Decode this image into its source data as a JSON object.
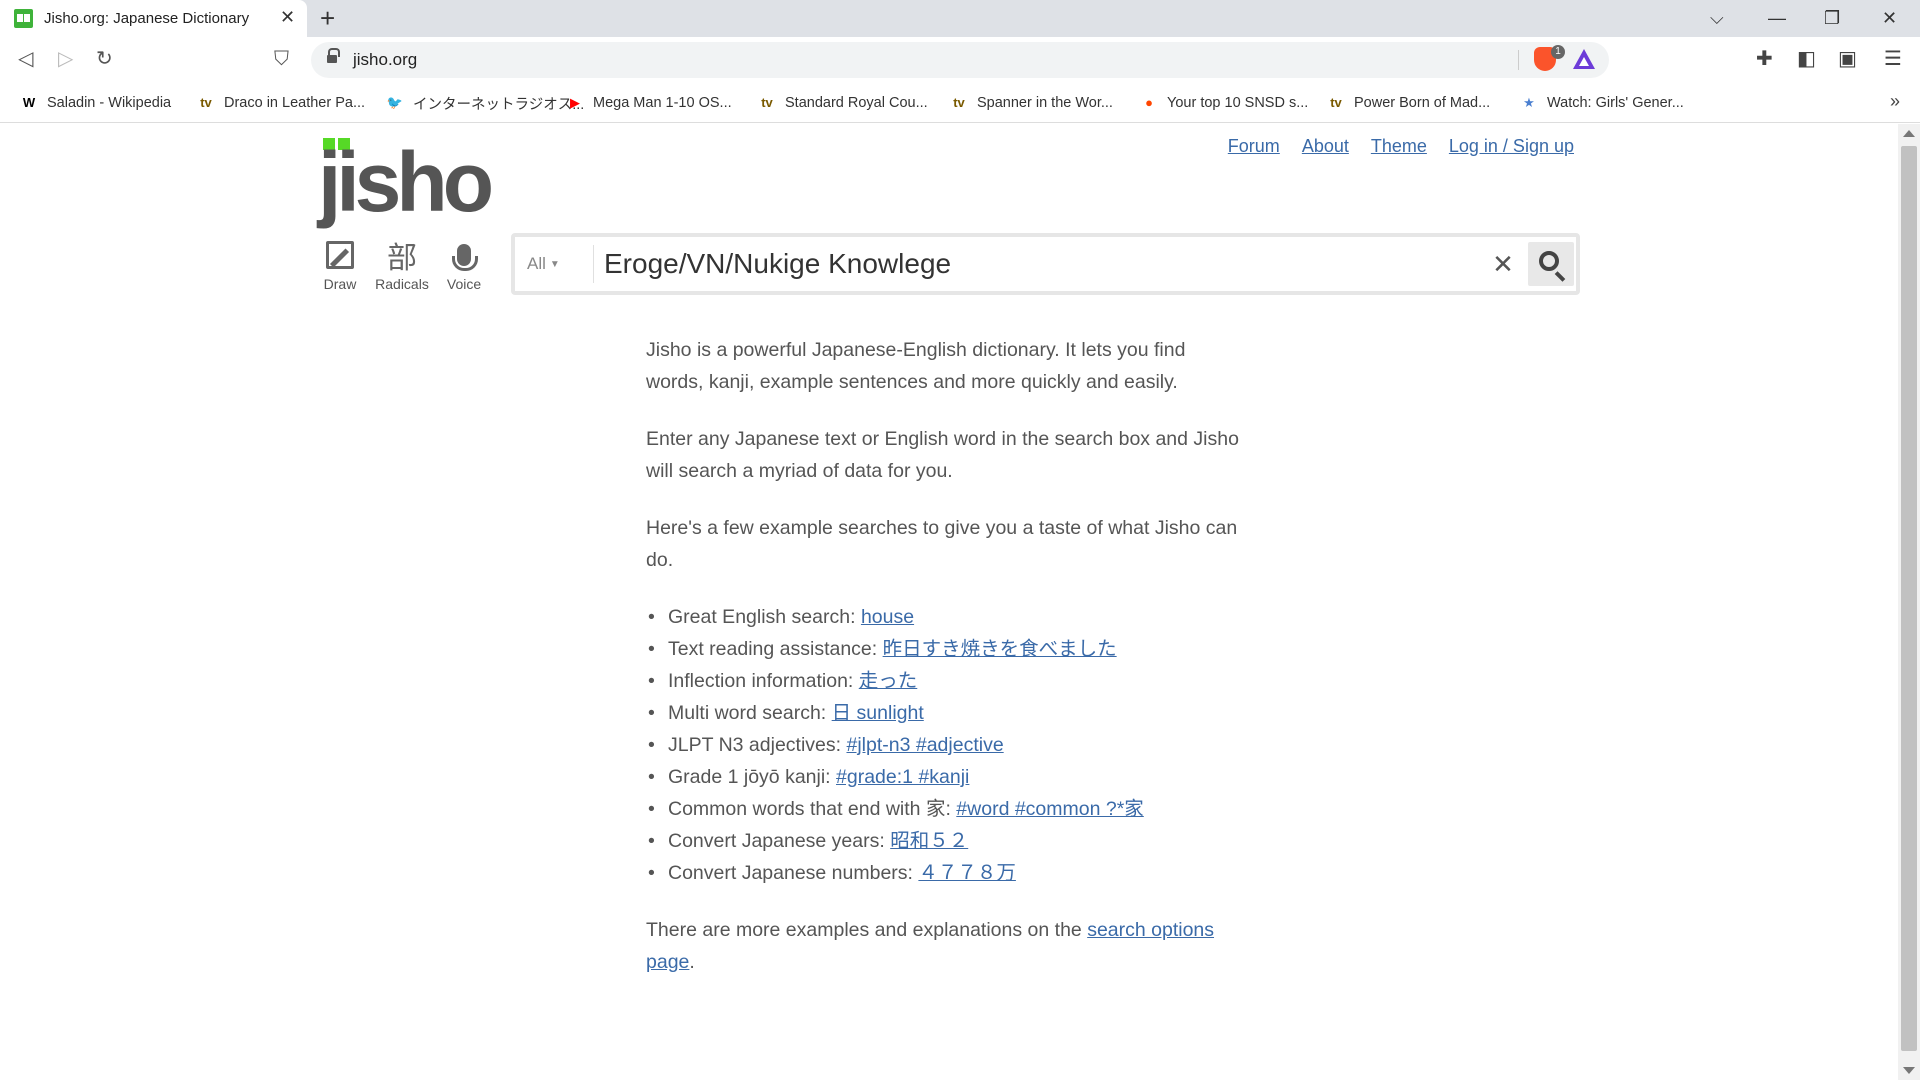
{
  "browser": {
    "tab_title": "Jisho.org: Japanese Dictionary",
    "tab_close": "✕",
    "new_tab": "+",
    "url": "jisho.org",
    "brave_badge": "1",
    "window_controls": [
      "⌵",
      "—",
      "❐",
      "✕"
    ],
    "bookmarks": [
      {
        "label": "Saladin - Wikipedia",
        "icon": "wikipedia-icon",
        "glyph": "W",
        "color": "#000000"
      },
      {
        "label": "Draco in Leather Pa...",
        "icon": "tvtropes-icon",
        "glyph": "tv",
        "color": "#7a5a00"
      },
      {
        "label": "インターネットラジオス...",
        "icon": "twitter-icon",
        "glyph": "🐦",
        "color": "#1d9bf0"
      },
      {
        "label": "Mega Man 1-10 OS...",
        "icon": "youtube-icon",
        "glyph": "▶",
        "color": "#ff0000"
      },
      {
        "label": "Standard Royal Cou...",
        "icon": "tvtropes-icon",
        "glyph": "tv",
        "color": "#7a5a00"
      },
      {
        "label": "Spanner in the Wor...",
        "icon": "tvtropes-icon",
        "glyph": "tv",
        "color": "#7a5a00"
      },
      {
        "label": "Your top 10 SNSD s...",
        "icon": "reddit-icon",
        "glyph": "●",
        "color": "#ff4500"
      },
      {
        "label": "Power Born of Mad...",
        "icon": "tvtropes-icon",
        "glyph": "tv",
        "color": "#7a5a00"
      },
      {
        "label": "Watch: Girls' Gener...",
        "icon": "star-icon",
        "glyph": "★",
        "color": "#4a7fd0"
      }
    ],
    "bookmarks_more": "»"
  },
  "site": {
    "logo": "jisho",
    "nav": [
      "Forum",
      "About",
      "Theme",
      "Log in / Sign up"
    ],
    "tools": [
      {
        "label": "Draw",
        "icon": "draw-icon"
      },
      {
        "label": "Radicals",
        "glyph": "部",
        "icon": "radicals-icon"
      },
      {
        "label": "Voice",
        "icon": "microphone-icon"
      }
    ],
    "search": {
      "category": "All",
      "category_arrow": "▼",
      "value": "Eroge/VN/Nukige Knowlege",
      "clear": "✕"
    }
  },
  "content": {
    "intro1": "Jisho is a powerful Japanese-English dictionary. It lets you find words, kanji, example sentences and more quickly and easily.",
    "intro2": "Enter any Japanese text or English word in the search box and Jisho will search a myriad of data for you.",
    "intro3": "Here's a few example searches to give you a taste of what Jisho can do.",
    "examples": [
      {
        "label": "Great English search: ",
        "link": "house"
      },
      {
        "label": "Text reading assistance: ",
        "link": "昨日すき焼きを食べました"
      },
      {
        "label": "Inflection information: ",
        "link": "走った"
      },
      {
        "label": "Multi word search: ",
        "link": "日 sunlight"
      },
      {
        "label": "JLPT N3 adjectives: ",
        "link": "#jlpt-n3 #adjective"
      },
      {
        "label": "Grade 1 jōyō kanji: ",
        "link": "#grade:1 #kanji"
      },
      {
        "label": "Common words that end with 家: ",
        "link": "#word #common ?*家"
      },
      {
        "label": "Convert Japanese years: ",
        "link": "昭和５２"
      },
      {
        "label": "Convert Japanese numbers: ",
        "link": "４７７８万"
      }
    ],
    "outro_text": "There are more examples and explanations on the ",
    "outro_link": "search options page",
    "outro_end": "."
  }
}
